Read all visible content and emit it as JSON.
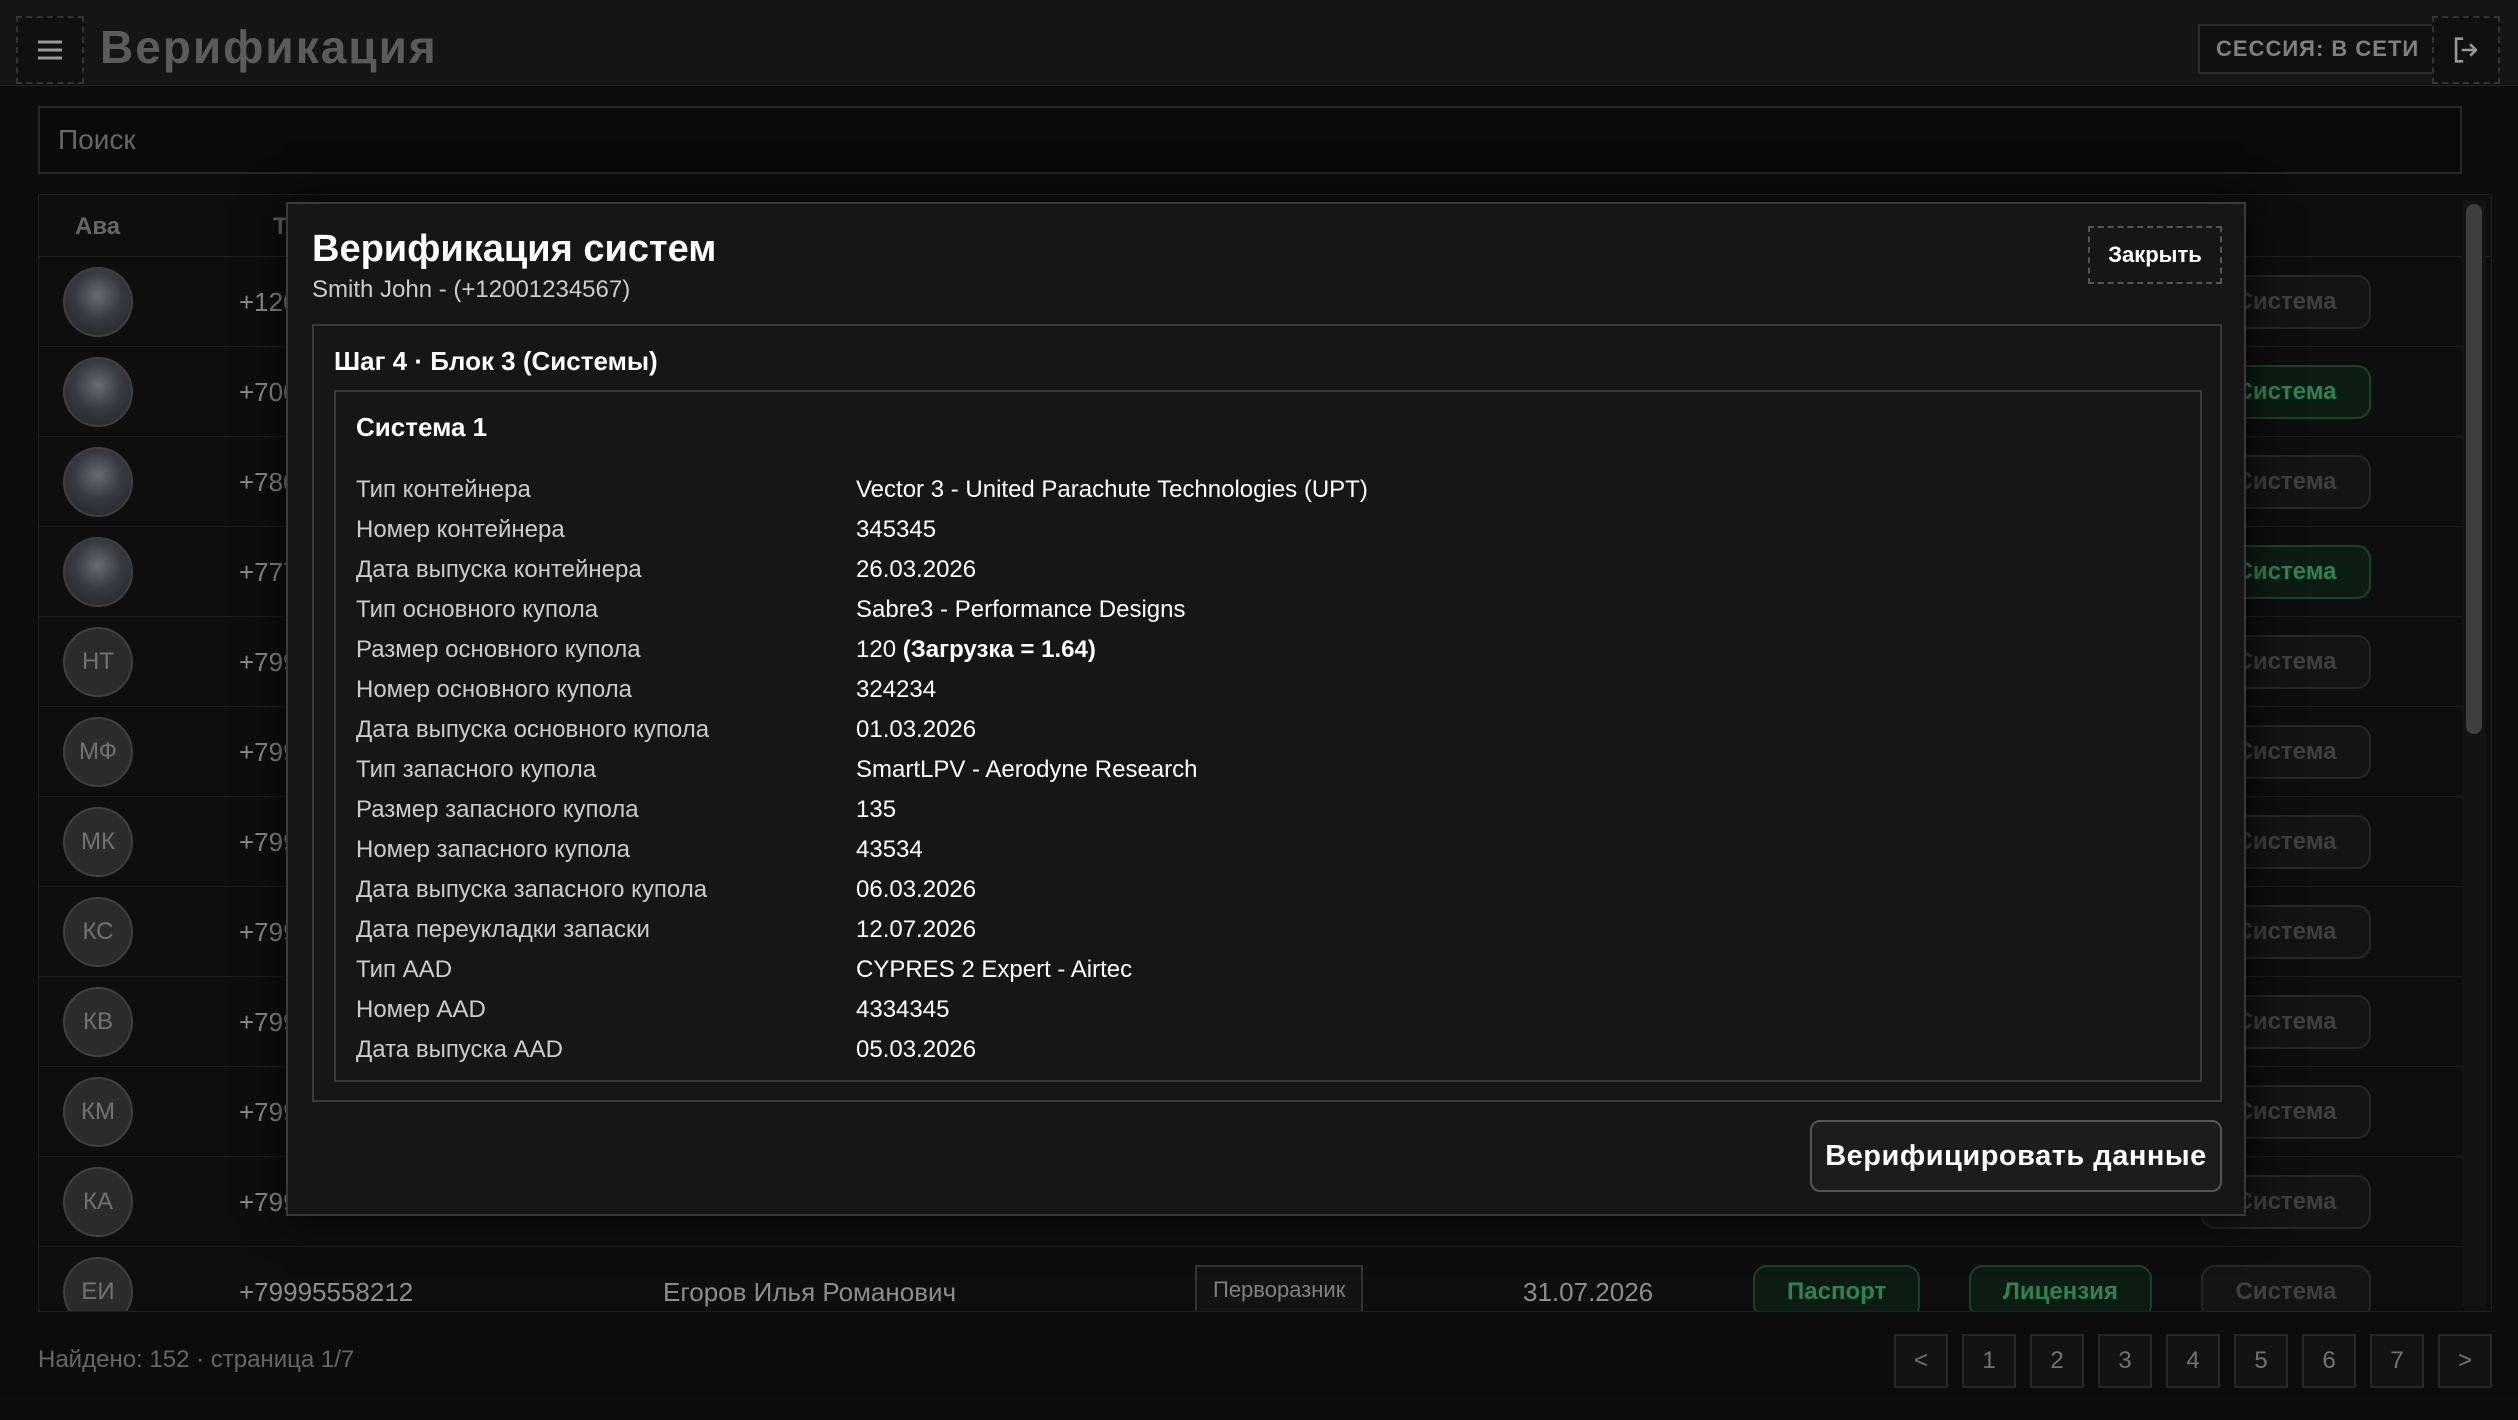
{
  "header": {
    "title": "Верификация",
    "session_label": "СЕССИЯ: В СЕТИ",
    "menu_icon": "hamburger-icon",
    "logout_icon": "logout-icon"
  },
  "search": {
    "placeholder": "Поиск"
  },
  "table": {
    "headers": [
      "Ава",
      "Т"
    ],
    "rows": [
      {
        "avatar": "",
        "phone": "+120",
        "system": "Система",
        "system_active": false
      },
      {
        "avatar": "",
        "phone": "+700",
        "system": "Система",
        "system_active": true
      },
      {
        "avatar": "",
        "phone": "+780",
        "system": "Система",
        "system_active": false
      },
      {
        "avatar": "",
        "phone": "+777",
        "system": "Система",
        "system_active": true
      },
      {
        "avatar": "НТ",
        "phone": "+799",
        "system": "Система",
        "system_active": false
      },
      {
        "avatar": "МФ",
        "phone": "+799",
        "system": "Система",
        "system_active": false
      },
      {
        "avatar": "МК",
        "phone": "+799",
        "system": "Система",
        "system_active": false
      },
      {
        "avatar": "КС",
        "phone": "+799",
        "system": "Система",
        "system_active": false
      },
      {
        "avatar": "КВ",
        "phone": "+799",
        "system": "Система",
        "system_active": false
      },
      {
        "avatar": "КМ",
        "phone": "+799",
        "system": "Система",
        "system_active": false
      },
      {
        "avatar": "КА",
        "phone": "+799",
        "system": "Система",
        "system_active": false
      },
      {
        "avatar": "ЕИ",
        "phone": "+79995558212",
        "fio": "Егоров Илья Романович",
        "type": "Перворазник",
        "date": "31.07.2026",
        "passport": "Паспорт",
        "license": "Лицензия",
        "system": "Система",
        "system_active": false
      }
    ]
  },
  "footer": {
    "found_text": "Найдено: 152 · страница 1/7",
    "pages": [
      "<",
      "1",
      "2",
      "3",
      "4",
      "5",
      "6",
      "7",
      ">"
    ]
  },
  "modal": {
    "title": "Верификация систем",
    "subtitle": "Smith John - (+12001234567)",
    "close_label": "Закрыть",
    "step_title": "Шаг 4 · Блок 3 (Системы)",
    "system_title": "Система 1",
    "fields": [
      {
        "label": "Тип контейнера",
        "value": "Vector 3 - United Parachute Technologies (UPT)"
      },
      {
        "label": "Номер контейнера",
        "value": "345345"
      },
      {
        "label": "Дата выпуска контейнера",
        "value": "26.03.2026"
      },
      {
        "label": "Тип основного купола",
        "value": "Sabre3 - Performance Designs"
      },
      {
        "label": "Размер основного купола",
        "value": "120",
        "extra": "(Загрузка = 1.64)"
      },
      {
        "label": "Номер основного купола",
        "value": "324234"
      },
      {
        "label": "Дата выпуска основного купола",
        "value": "01.03.2026"
      },
      {
        "label": "Тип запасного купола",
        "value": "SmartLPV - Aerodyne Research"
      },
      {
        "label": "Размер запасного купола",
        "value": "135"
      },
      {
        "label": "Номер запасного купола",
        "value": "43534"
      },
      {
        "label": "Дата выпуска запасного купола",
        "value": "06.03.2026"
      },
      {
        "label": "Дата переукладки запаски",
        "value": "12.07.2026"
      },
      {
        "label": "Тип AAD",
        "value": "CYPRES 2 Expert - Airtec"
      },
      {
        "label": "Номер AAD",
        "value": "4334345"
      },
      {
        "label": "Дата выпуска AAD",
        "value": "05.03.2026"
      }
    ],
    "verify_label": "Верифицировать данные"
  }
}
